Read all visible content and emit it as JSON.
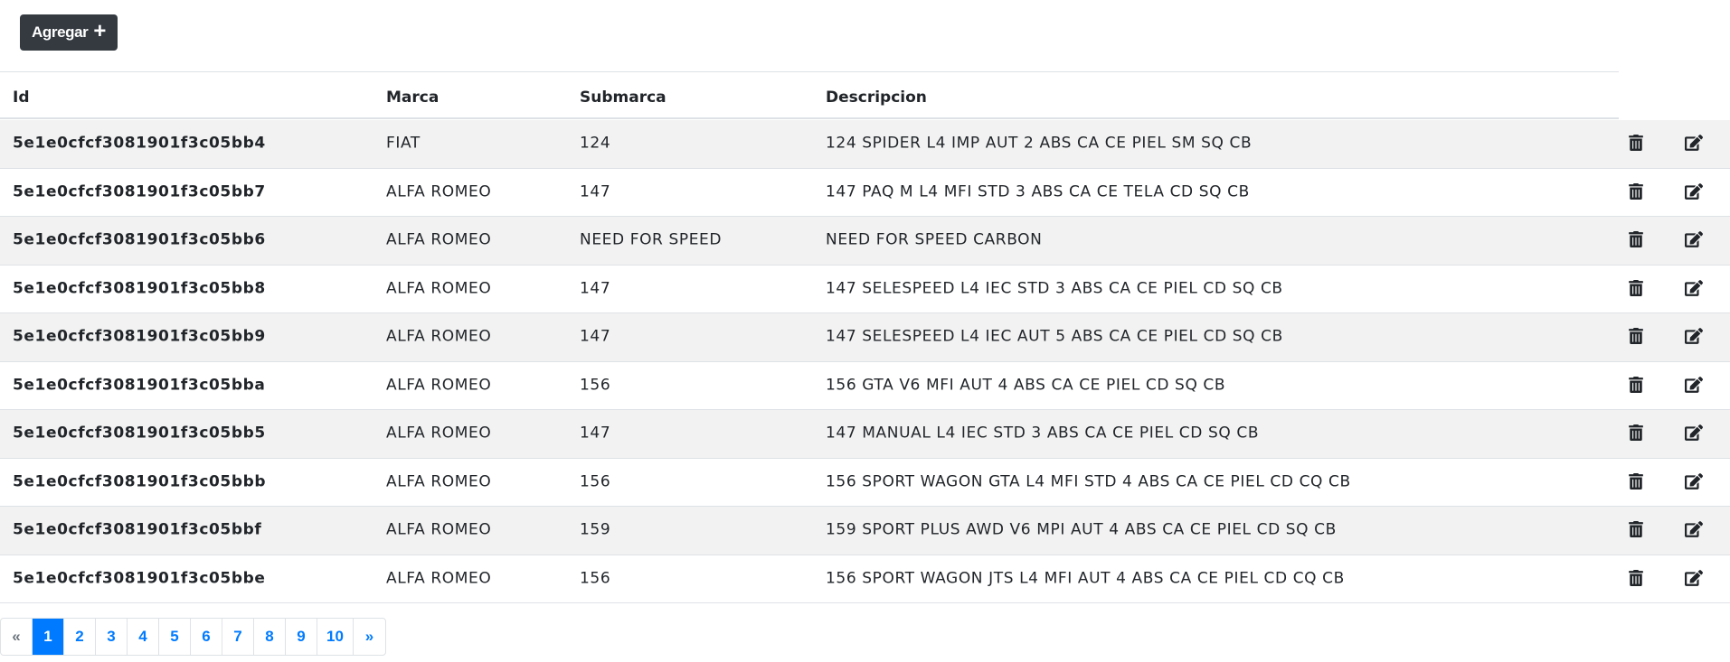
{
  "toolbar": {
    "add_label": "Agregar"
  },
  "table": {
    "headers": {
      "id": "Id",
      "marca": "Marca",
      "submarca": "Submarca",
      "descripcion": "Descripcion"
    },
    "rows": [
      {
        "id": "5e1e0cfcf3081901f3c05bb4",
        "marca": "FIAT",
        "submarca": "124",
        "descripcion": "124 SPIDER L4 IMP AUT 2 ABS CA CE PIEL SM SQ CB"
      },
      {
        "id": "5e1e0cfcf3081901f3c05bb7",
        "marca": "ALFA ROMEO",
        "submarca": "147",
        "descripcion": "147 PAQ M L4 MFI STD 3 ABS CA CE TELA CD SQ CB"
      },
      {
        "id": "5e1e0cfcf3081901f3c05bb6",
        "marca": "ALFA ROMEO",
        "submarca": "NEED FOR SPEED",
        "descripcion": "NEED FOR SPEED CARBON"
      },
      {
        "id": "5e1e0cfcf3081901f3c05bb8",
        "marca": "ALFA ROMEO",
        "submarca": "147",
        "descripcion": "147 SELESPEED L4 IEC STD 3 ABS CA CE PIEL CD SQ CB"
      },
      {
        "id": "5e1e0cfcf3081901f3c05bb9",
        "marca": "ALFA ROMEO",
        "submarca": "147",
        "descripcion": "147 SELESPEED L4 IEC AUT 5 ABS CA CE PIEL CD SQ CB"
      },
      {
        "id": "5e1e0cfcf3081901f3c05bba",
        "marca": "ALFA ROMEO",
        "submarca": "156",
        "descripcion": "156 GTA V6 MFI AUT 4 ABS CA CE PIEL CD SQ CB"
      },
      {
        "id": "5e1e0cfcf3081901f3c05bb5",
        "marca": "ALFA ROMEO",
        "submarca": "147",
        "descripcion": "147 MANUAL L4 IEC STD 3 ABS CA CE PIEL CD SQ CB"
      },
      {
        "id": "5e1e0cfcf3081901f3c05bbb",
        "marca": "ALFA ROMEO",
        "submarca": "156",
        "descripcion": "156 SPORT WAGON GTA L4 MFI STD 4 ABS CA CE PIEL CD CQ CB"
      },
      {
        "id": "5e1e0cfcf3081901f3c05bbf",
        "marca": "ALFA ROMEO",
        "submarca": "159",
        "descripcion": "159 SPORT PLUS AWD V6 MPI AUT 4 ABS CA CE PIEL CD SQ CB"
      },
      {
        "id": "5e1e0cfcf3081901f3c05bbe",
        "marca": "ALFA ROMEO",
        "submarca": "156",
        "descripcion": "156 SPORT WAGON JTS L4 MFI AUT 4 ABS CA CE PIEL CD CQ CB"
      }
    ]
  },
  "pagination": {
    "prev": "«",
    "next": "»",
    "pages": [
      "1",
      "2",
      "3",
      "4",
      "5",
      "6",
      "7",
      "8",
      "9",
      "10"
    ],
    "current": "1"
  },
  "colors": {
    "primary": "#007bff",
    "dark_button": "#343a40",
    "stripe": "#f2f2f2",
    "border": "#dee2e6"
  },
  "icons": {
    "delete": "trash-icon",
    "edit": "edit-icon",
    "add": "plus-icon"
  }
}
